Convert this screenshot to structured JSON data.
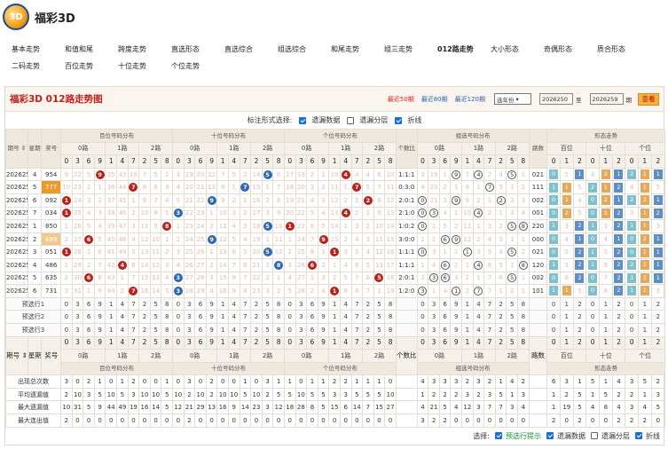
{
  "brand": {
    "title": "福彩3D",
    "logo": "3D"
  },
  "nav": {
    "row1": [
      "基本走势",
      "和值和尾",
      "跨度走势",
      "直选形态",
      "直选综合",
      "组选综合",
      "和尾走势",
      "组三走势",
      "012路走势",
      "大小形态",
      "奇偶形态",
      "质合形态"
    ],
    "row2": [
      "二码走势",
      "百位走势",
      "十位走势",
      "个位走势"
    ],
    "active": "012路走势"
  },
  "panel": {
    "title": "福彩3D 012路走势图",
    "recent": [
      "最近50期",
      "最近80期",
      "最近120期"
    ],
    "select": "选年份",
    "from": "2026250",
    "to_label": "至",
    "to": "2026259",
    "period": "期",
    "query": "查看"
  },
  "options": {
    "label": "标注形式选择:",
    "items": [
      "遗漏数据",
      "遗漏分层",
      "折线"
    ]
  },
  "headers": {
    "issue": "期号",
    "week": "星期",
    "prize": "奖号",
    "bai": "百位号码分布",
    "shi": "十位号码分布",
    "ge": "个位号码分布",
    "count": "个数比",
    "group": "组选号码分布",
    "lushu": "路数",
    "form": "形态走势",
    "form_sub": [
      "百位",
      "十位",
      "个位"
    ],
    "route": [
      "0路",
      "1路",
      "2路"
    ],
    "digits": [
      "0",
      "3",
      "6",
      "9",
      "1",
      "4",
      "7",
      "2",
      "5",
      "8"
    ],
    "form_digits": [
      "0",
      "1",
      "2"
    ]
  },
  "rows": [
    {
      "issue": "2026250",
      "week": "4",
      "prize": "954",
      "bai": "9 22 5 ❾ 35 43 19 7 5 2",
      "shi": "3 19 20 12 7 5 2 14 ❺ 6",
      "ge": "17 19 2 1 10 ❹ 4 4 6 10",
      "ratio": "1:1:1",
      "group": "3 19 1 ⑨ 7 ④ 2 4 ⑤ 1",
      "ls": "021",
      "f": "0 5 1 4 2 1 2 1 1"
    },
    {
      "issue": "2026251",
      "week": "5",
      "prize": "777",
      "bai": "10 23 2 1 36 44 ❼ 8 6 3",
      "shi": "4 20 21 13 8 1 ❼ 15 1 7",
      "ge": "18 20 3 2 11 1 ❼ 5 7 11",
      "ratio": "0:3:0",
      "group": "4 20 2 1 8 1 ⑦ 5 1 2",
      "ls": "111",
      "f": "1 1 5 2 1 2 4 1 5"
    },
    {
      "issue": "2026252",
      "week": "6",
      "prize": "092",
      "bai": "❶ 24 3 2 37 45 1 9 7 4",
      "shi": "5 21 22 ❾ 9 2 1 16 2 8",
      "ge": "19 21 4 3 12 2 1 ❷ 8 12",
      "ratio": "2:0:1",
      "group": "⓪ 21 3 ⑨ 9 2 1 ② 3 3",
      "ls": "002",
      "f": "0 1 4 0 2 1 2 2 1"
    },
    {
      "issue": "2026253",
      "week": "7",
      "prize": "034",
      "bai": "❶ 25 4 3 38 46 2 10 8 5",
      "shi": "❸ 22 23 1 10 3 2 17 3 9",
      "ge": "20 22 5 4 13 ❹ 2 1 9 13",
      "ratio": "2:1:0",
      "group": "⓪ ③ 4 1 10 ④ 2 1 3 4",
      "ls": "001",
      "f": "0 2 5 0 1 2 3 1 2"
    },
    {
      "issue": "2026254",
      "week": "1",
      "prize": "850",
      "bai": "1 26 5 4 39 47 3 11 9 ❽",
      "shi": "1 23 24 2 11 4 3 18 ❺ 10",
      "ge": "❶ 23 6 5 14 1 3 2 10 14",
      "ratio": "1:0:2",
      "group": "⓪ 1 5 2 11 1 3 2 ⑤ ⑧",
      "ls": "220",
      "f": "1 3 2 1 3 2 1 1 3"
    },
    {
      "issue": "2026255",
      "week": "2",
      "prize": "699",
      "bai": "2 27 ❻ 5 40 48 4 12 10 1",
      "shi": "2 24 25 ❾ 12 5 4 19 1 11",
      "ge": "1 24 7 ❾ 15 2 4 3 11 15",
      "ratio": "3:0:0",
      "group": "1 2 ⑥ ⑨ 12 2 4 3 1 1",
      "ls": "000",
      "f": "0 4 1 0 4 1 0 2 1"
    },
    {
      "issue": "2026256",
      "week": "3",
      "prize": "051",
      "bai": "❶ 28 1 6 41 49 5 13 11 2",
      "shi": "3 25 26 1 13 6 5 20 ❺ 12",
      "ge": "2 25 8 1 ❶ 3 5 4 12 16",
      "ratio": "1:1:1",
      "group": "⓪ 3 1 1 ① 3 5 4 ⑤ 2",
      "ls": "021",
      "f": "0 5 2 1 5 2 0 1 1"
    },
    {
      "issue": "2026257",
      "week": "4",
      "prize": "486",
      "bai": "1 29 2 7 42 ❹ 6 14 12 3",
      "shi": "4 26 27 2 14 7 6 21 1 ❽",
      "ge": "3 26 ❻ 2 1 4 6 5 13 17",
      "ratio": "1:1:1",
      "group": "1 4 ⑥ 2 1 ④ 6 5 1 ⑧",
      "ls": "120",
      "f": "1 3 2 1 6 2 2 1 1"
    },
    {
      "issue": "2026258",
      "week": "5",
      "prize": "635",
      "bai": "2 30 ❻ 8 43 1 7 15 13 4",
      "shi": "❸ 27 28 3 15 8 7 22 2 1",
      "ge": "4 27 1 3 2 5 7 6 ❺ 18",
      "ratio": "2:0:1",
      "group": "2 ③ ⑥ 3 2 1 7 6 ⑤ 1",
      "ls": "002",
      "f": "0 6 2 0 7 2 1 2 1"
    },
    {
      "issue": "2026259",
      "week": "6",
      "prize": "731",
      "bai": "3 31 1 9 44 2 ❼ 16 14 5",
      "shi": "❸ 28 29 4 16 9 8 23 3 2",
      "ge": "5 28 2 4 ❶ 6 8 7 1 19",
      "ratio": "1:2:0",
      "group": "③ 1 4 ① 2 ⑦ 7 1 2 1",
      "ls": "101",
      "f": "1 1 5 0 8 2 1 1 3"
    }
  ],
  "forecast": [
    "预选行1",
    "预选行2",
    "预选行3"
  ],
  "stats": [
    {
      "label": "出现总次数",
      "bai": "3 0 2 1 0 1 2 0 0 1",
      "shi": "0 3 0 2 0 0 1 0 3 1",
      "ge": "1 0 1 1 2 2 1 1 1 0",
      "group": "4 3 3 3 2 3 2 1 4 2",
      "form": "6 3 1 5 1 4 3 5 2"
    },
    {
      "label": "平均遗漏值",
      "bai": "2 10 3 5 10 5 3 10 10 5",
      "shi": "10 2 10 2 10 10 5 10 2 5",
      "ge": "5 10 5 5 3 3 5 5 5 10",
      "group": "1 2 2 2 3 2 3 5 1 3",
      "form": "1 2 5 1 5 2 2 1 3"
    },
    {
      "label": "最大遗漏值",
      "bai": "10 31 5 9 44 49 19 16 14 5",
      "shi": "12 21 29 13 16 9 14 23 3 12",
      "ge": "18 28 8 5 15 6 14 7 15 27",
      "group": "4 21 5 4 12 3 7 7 3 4",
      "form": "1 19 5 4 8 4 3 4 5"
    },
    {
      "label": "最大连出值",
      "bai": "2 0 0 0 0 0 0 0 0 0",
      "shi": "0 2 0 0 0 0 0 0 0 0",
      "ge": "0 0 0 0 0 0 0 0 0 0",
      "group": "3 2 2 0 0 0 0 0 0 0",
      "form": "2 0 2 0 0 2 2 2 0"
    }
  ],
  "foot": {
    "label": "选择:",
    "items": [
      "预选行提示",
      "遗漏数据",
      "遗漏分层",
      "折线"
    ]
  }
}
